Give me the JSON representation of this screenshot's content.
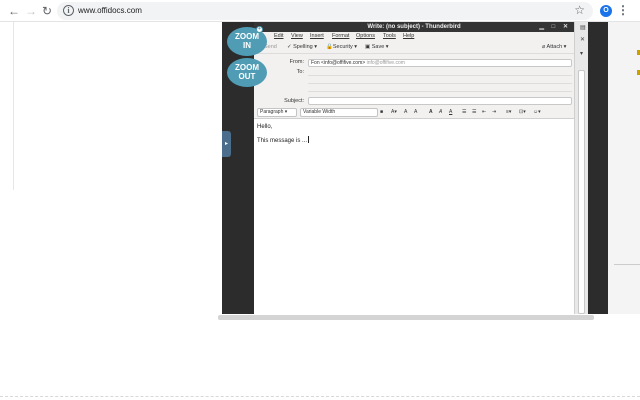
{
  "browser": {
    "url": "www.offidocs.com",
    "icons": {
      "back": "arrow-left-icon",
      "forward": "arrow-right-icon",
      "reload": "reload-icon",
      "info": "info-icon",
      "bookmark": "star-icon",
      "menu": "vertical-dots-icon"
    },
    "accent_color": "#1a73e8"
  },
  "zoom": {
    "in_line1": "ZOOM",
    "in_line2": "IN",
    "out_line1": "ZOOM",
    "out_line2": "OUT",
    "color": "#4f9cb4"
  },
  "window": {
    "title": "Write: (no subject) - Thunderbird",
    "controls": "▁ □ ✕"
  },
  "menu": [
    "Edit",
    "View",
    "Insert",
    "Format",
    "Options",
    "Tools",
    "Help"
  ],
  "toolbar": {
    "send": "Send",
    "spelling": "Spelling",
    "security": "Security",
    "save": "Save",
    "attach": "Attach"
  },
  "headers": {
    "from_label": "From:",
    "from_value": "Fon <info@offifive.com>",
    "from_alias": "info@offifive.com",
    "to_label": "To:",
    "subject_label": "Subject:"
  },
  "format": {
    "paragraph": "Paragraph",
    "font": "Variable Width"
  },
  "body": {
    "line1": "Hello,",
    "line2": "This message is ..."
  }
}
